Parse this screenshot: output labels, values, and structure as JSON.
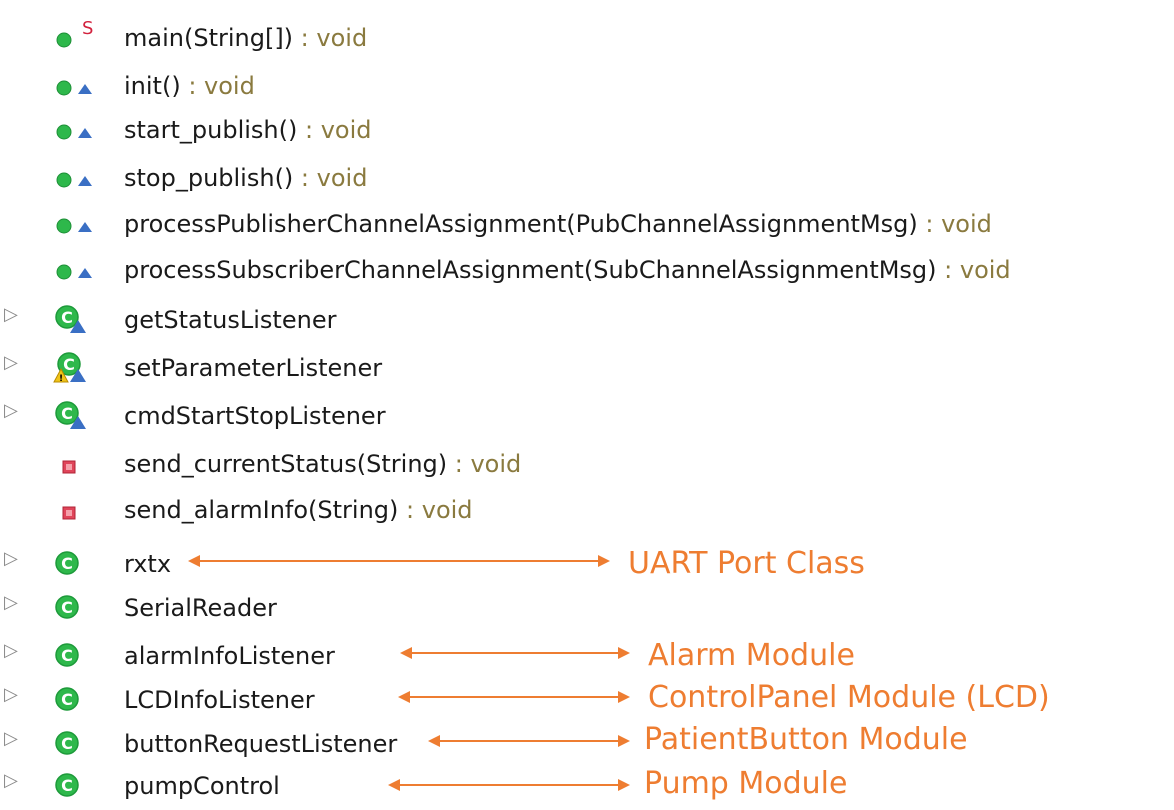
{
  "members": [
    {
      "name": "main(String[])",
      "type": " : void",
      "icon": "public-static-method-icon",
      "static_marker": "S"
    },
    {
      "name": "init()",
      "type": " : void",
      "icon": "package-method-icon"
    },
    {
      "name": "start_publish()",
      "type": " : void",
      "icon": "package-method-icon"
    },
    {
      "name": "stop_publish()",
      "type": " : void",
      "icon": "package-method-icon"
    },
    {
      "name": "processPublisherChannelAssignment(PubChannelAssignmentMsg)",
      "type": " : void",
      "icon": "package-method-icon"
    },
    {
      "name": "processSubscriberChannelAssignment(SubChannelAssignmentMsg)",
      "type": " : void",
      "icon": "package-method-icon"
    },
    {
      "name": "getStatusListener",
      "type": "",
      "icon": "package-class-icon",
      "expandable": true
    },
    {
      "name": "setParameterListener",
      "type": "",
      "icon": "package-class-warning-icon",
      "expandable": true
    },
    {
      "name": "cmdStartStopListener",
      "type": "",
      "icon": "package-class-icon",
      "expandable": true
    },
    {
      "name": "send_currentStatus(String)",
      "type": " : void",
      "icon": "private-method-icon"
    },
    {
      "name": "send_alarmInfo(String)",
      "type": " : void",
      "icon": "private-method-icon"
    },
    {
      "name": "rxtx",
      "type": "",
      "icon": "public-class-icon",
      "expandable": true
    },
    {
      "name": "SerialReader",
      "type": "",
      "icon": "public-class-icon",
      "expandable": true
    },
    {
      "name": "alarmInfoListener",
      "type": "",
      "icon": "public-class-icon",
      "expandable": true
    },
    {
      "name": "LCDInfoListener",
      "type": "",
      "icon": "public-class-icon",
      "expandable": true
    },
    {
      "name": "buttonRequestListener",
      "type": "",
      "icon": "public-class-icon",
      "expandable": true
    },
    {
      "name": "pumpControl",
      "type": "",
      "icon": "public-class-icon",
      "expandable": true
    }
  ],
  "annotations": [
    {
      "text": "UART Port Class",
      "target": "rxtx"
    },
    {
      "text": "Alarm Module",
      "target": "alarmInfoListener"
    },
    {
      "text": "ControlPanel Module (LCD)",
      "target": "LCDInfoListener"
    },
    {
      "text": "PatientButton Module",
      "target": "buttonRequestListener"
    },
    {
      "text": "Pump Module",
      "target": "pumpControl"
    }
  ],
  "colors": {
    "annotation": "#ee7d31",
    "method_green": "#2eb84b",
    "private_red": "#e0455a",
    "class_green": "#1d9a3a",
    "package_blue": "#3a6fc4",
    "warning_yellow": "#f0c419",
    "type_text": "#8a7a3f"
  }
}
